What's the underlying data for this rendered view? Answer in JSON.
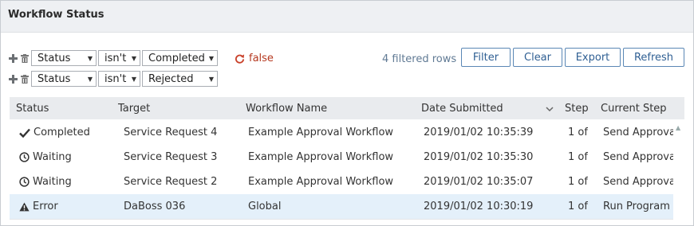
{
  "panel": {
    "title": "Workflow Status"
  },
  "filters": [
    {
      "field": "Status",
      "operator": "isn't",
      "value": "Completed"
    },
    {
      "field": "Status",
      "operator": "isn't",
      "value": "Rejected"
    }
  ],
  "toggle": {
    "label": "false",
    "icon": "refresh-icon",
    "color": "#b5381f"
  },
  "toolbar": {
    "row_count": "4 filtered rows",
    "filter_label": "Filter",
    "clear_label": "Clear",
    "export_label": "Export",
    "refresh_label": "Refresh",
    "accent": "#2f5f93"
  },
  "table": {
    "columns": [
      "Status",
      "Target",
      "Workflow Name",
      "Date Submitted",
      "Step",
      "Current Step"
    ],
    "sorted_column": "Date Submitted",
    "sort_direction": "descending",
    "rows": [
      {
        "status_icon": "check-icon",
        "status": "Completed",
        "target": "Service Request 4",
        "workflow": "Example Approval Workflow",
        "date": "2019/01/02 10:35:39",
        "step": "1 of",
        "current": "Send Approval"
      },
      {
        "status_icon": "clock-icon",
        "status": "Waiting",
        "target": "Service Request 3",
        "workflow": "Example Approval Workflow",
        "date": "2019/01/02 10:35:30",
        "step": "1 of",
        "current": "Send Approval"
      },
      {
        "status_icon": "clock-icon",
        "status": "Waiting",
        "target": "Service Request 2",
        "workflow": "Example Approval Workflow",
        "date": "2019/01/02 10:35:07",
        "step": "1 of",
        "current": "Send Approval"
      },
      {
        "status_icon": "warning-icon",
        "status": "Error",
        "target": "DaBoss 036",
        "workflow": "Global",
        "date": "2019/01/02 10:30:19",
        "step": "1 of",
        "current": "Run Program",
        "selected": true
      }
    ]
  }
}
